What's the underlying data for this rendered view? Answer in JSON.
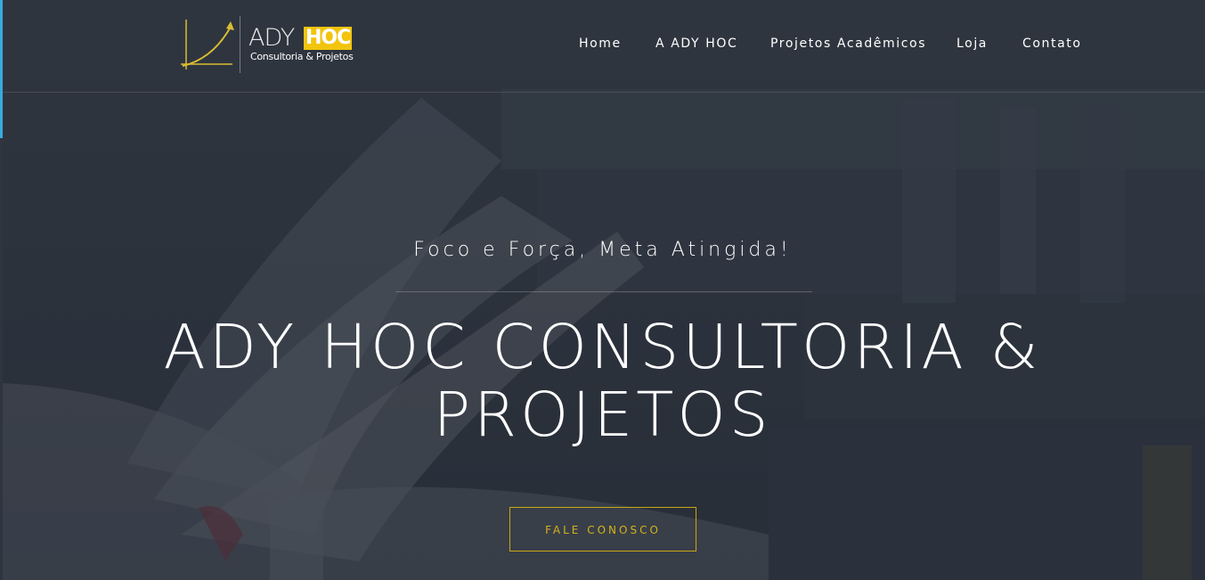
{
  "brand": {
    "name_part1": "ADY",
    "name_part2": "HOC",
    "subtitle": "Consultoria & Projetos",
    "accent_color": "#f2c40e",
    "logo_icon": "growth-chart-icon"
  },
  "nav": {
    "items": [
      {
        "label": "Home"
      },
      {
        "label": "A ADY HOC"
      },
      {
        "label": "Projetos Acadêmicos"
      },
      {
        "label": "Loja"
      },
      {
        "label": "Contato"
      }
    ]
  },
  "hero": {
    "tagline": "Foco e Força, Meta Atingida!",
    "title": "ADY HOC CONSULTORIA & PROJETOS",
    "cta_label": "FALE CONOSCO",
    "cta_color": "#d4b21a",
    "background": "open-book-library-photo"
  }
}
